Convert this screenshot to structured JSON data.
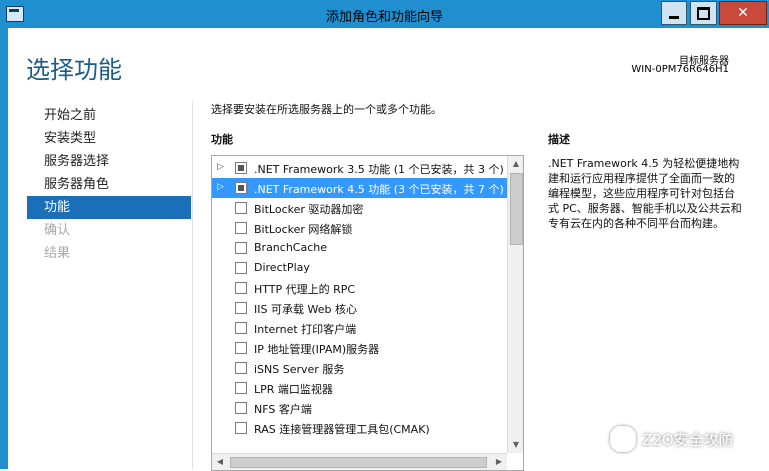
{
  "window": {
    "title": "添加角色和功能向导",
    "close_glyph": "✕"
  },
  "header": {
    "page_title": "选择功能",
    "destination_label": "目标服务器",
    "destination_value": "WIN-0PM76R646H1"
  },
  "nav": {
    "items": [
      {
        "label": "开始之前",
        "state": "normal"
      },
      {
        "label": "安装类型",
        "state": "normal"
      },
      {
        "label": "服务器选择",
        "state": "normal"
      },
      {
        "label": "服务器角色",
        "state": "normal"
      },
      {
        "label": "功能",
        "state": "active"
      },
      {
        "label": "确认",
        "state": "disabled"
      },
      {
        "label": "结果",
        "state": "disabled"
      }
    ]
  },
  "content": {
    "instruction": "选择要安装在所选服务器上的一个或多个功能。",
    "features_heading": "功能",
    "description_heading": "描述",
    "description_text": ".NET Framework 4.5 为轻松便捷地构建和运行应用程序提供了全面而一致的编程模型，这些应用程序可针对包括台式 PC、服务器、智能手机以及公共云和专有云在内的各种不同平台而构建。"
  },
  "features": [
    {
      "label": ".NET Framework 3.5 功能 (1 个已安装，共 3 个)",
      "expandable": true,
      "check": "partial",
      "selected": false
    },
    {
      "label": ".NET Framework 4.5 功能 (3 个已安装，共 7 个)",
      "expandable": true,
      "check": "partial",
      "selected": true
    },
    {
      "label": "BitLocker 驱动器加密",
      "expandable": false,
      "check": "none",
      "selected": false
    },
    {
      "label": "BitLocker 网络解锁",
      "expandable": false,
      "check": "none",
      "selected": false
    },
    {
      "label": "BranchCache",
      "expandable": false,
      "check": "none",
      "selected": false
    },
    {
      "label": "DirectPlay",
      "expandable": false,
      "check": "none",
      "selected": false
    },
    {
      "label": "HTTP 代理上的 RPC",
      "expandable": false,
      "check": "none",
      "selected": false
    },
    {
      "label": "IIS 可承载 Web 核心",
      "expandable": false,
      "check": "none",
      "selected": false
    },
    {
      "label": "Internet 打印客户端",
      "expandable": false,
      "check": "none",
      "selected": false
    },
    {
      "label": "IP 地址管理(IPAM)服务器",
      "expandable": false,
      "check": "none",
      "selected": false
    },
    {
      "label": "iSNS Server 服务",
      "expandable": false,
      "check": "none",
      "selected": false
    },
    {
      "label": "LPR 端口监视器",
      "expandable": false,
      "check": "none",
      "selected": false
    },
    {
      "label": "NFS 客户端",
      "expandable": false,
      "check": "none",
      "selected": false
    },
    {
      "label": "RAS 连接管理器管理工具包(CMAK)",
      "expandable": false,
      "check": "none",
      "selected": false
    }
  ],
  "scroll": {
    "up": "▲",
    "down": "▼",
    "left": "◀",
    "right": "▶",
    "expander": "▷"
  },
  "watermark": {
    "text": "Z2O安全攻防"
  },
  "colors": {
    "titlebar": "#1f8fcf",
    "nav_active": "#1a6fb8",
    "selection": "#3399ff",
    "close_button": "#c94a3a",
    "page_title": "#1a5d8a"
  }
}
